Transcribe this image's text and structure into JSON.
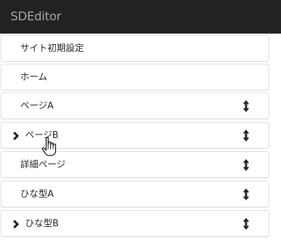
{
  "app": {
    "title": "SDEditor"
  },
  "colors": {
    "header_bg": "#222222",
    "header_text": "#a8a8a8",
    "item_border": "#dcdcdc",
    "item_text": "#222222"
  },
  "nav": {
    "items": [
      {
        "label": "サイト初期設定",
        "has_children": false,
        "sortable": false
      },
      {
        "label": "ホーム",
        "has_children": false,
        "sortable": false
      },
      {
        "label": "ページA",
        "has_children": false,
        "sortable": true
      },
      {
        "label": "ページB",
        "has_children": true,
        "sortable": true
      },
      {
        "label": "詳細ページ",
        "has_children": false,
        "sortable": true
      },
      {
        "label": "ひな型A",
        "has_children": false,
        "sortable": true
      },
      {
        "label": "ひな型B",
        "has_children": true,
        "sortable": true
      }
    ]
  },
  "icons": {
    "expand": "chevron-right-icon",
    "sort": "vertical-resize-icon",
    "pointer": "hand-pointer-icon"
  }
}
